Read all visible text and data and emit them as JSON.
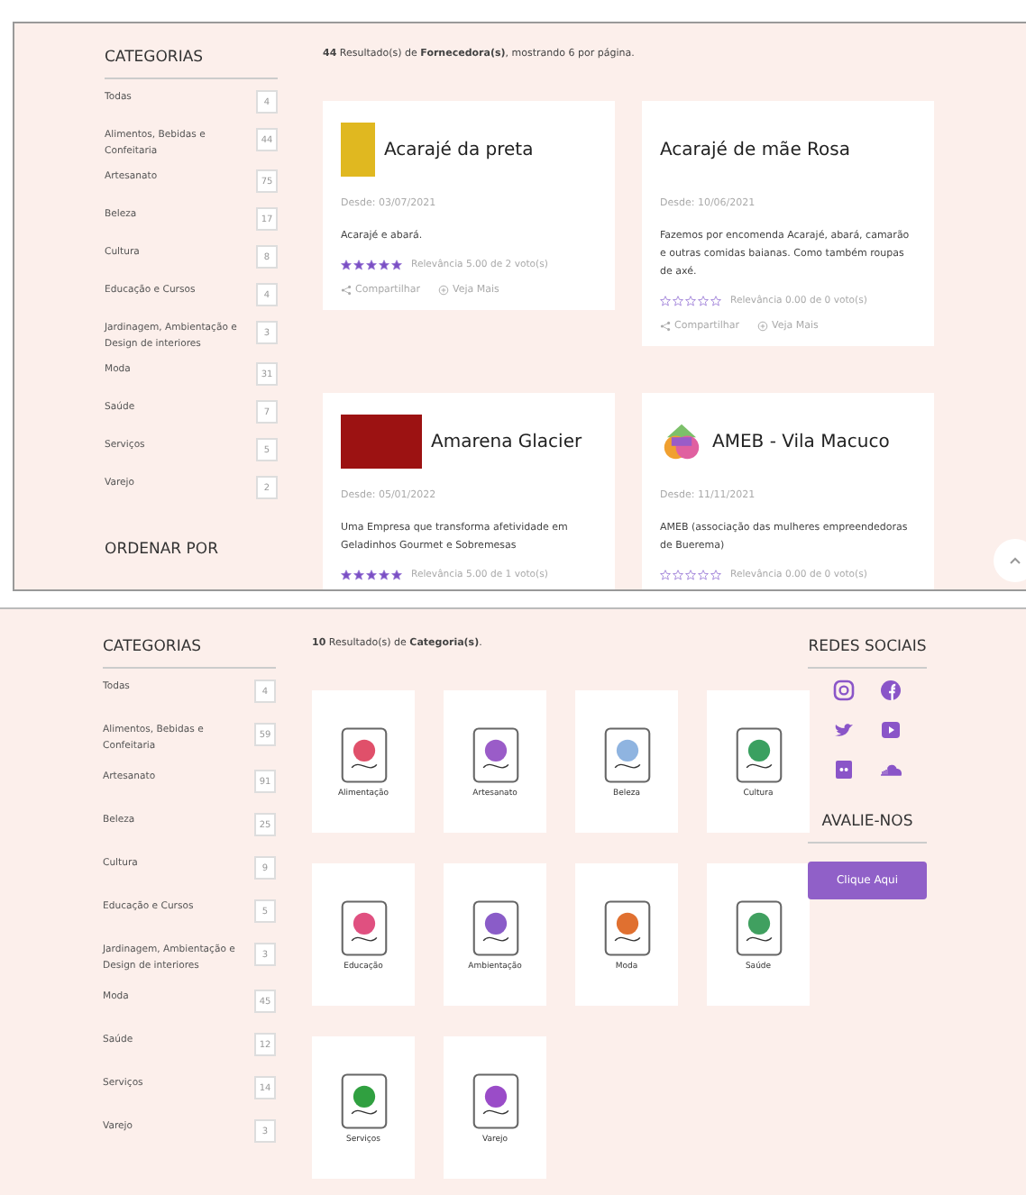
{
  "top_panel": {
    "sidebar": {
      "title": "CATEGORIAS",
      "items": [
        {
          "label": "Todas",
          "count": "4"
        },
        {
          "label": "Alimentos, Bebidas e Confeitaria",
          "count": "44"
        },
        {
          "label": "Artesanato",
          "count": "75"
        },
        {
          "label": "Beleza",
          "count": "17"
        },
        {
          "label": "Cultura",
          "count": "8"
        },
        {
          "label": "Educação e Cursos",
          "count": "4"
        },
        {
          "label": "Jardinagem, Ambientação e Design de interiores",
          "count": "3"
        },
        {
          "label": "Moda",
          "count": "31"
        },
        {
          "label": "Saúde",
          "count": "7"
        },
        {
          "label": "Serviços",
          "count": "5"
        },
        {
          "label": "Varejo",
          "count": "2"
        }
      ],
      "section_title": "ORDENAR POR"
    },
    "results": "**44** Resultado(s) de **Fornecedora(s)**, mostrando 6 por página.",
    "cards": [
      {
        "kind": "photo",
        "color": "#e0b820",
        "name": "Acarajé da preta",
        "since": "Desde: 03/07/2021",
        "description": "Acarajé e abará.",
        "stars": 5,
        "rating": "Relevância 5.00 de 2 voto(s)",
        "share": "Compartilhar",
        "more": "Veja Mais"
      },
      {
        "kind": "plain",
        "name": "Acarajé de mãe Rosa",
        "since": "Desde: 10/06/2021",
        "description": "Fazemos por encomenda Acarajé, abará, camarão e outras comidas baianas. Como também roupas de axé.",
        "stars": 0,
        "rating": "Relevância 0.00 de 0 voto(s)",
        "share": "Compartilhar",
        "more": "Veja Mais"
      },
      {
        "kind": "photo",
        "color": "#9c1212",
        "name": "Amarena Glacier",
        "since": "Desde: 05/01/2022",
        "description": "Uma Empresa que transforma afetividade em Geladinhos Gourmet e Sobremesas",
        "stars": 5,
        "rating": "Relevância 5.00 de 1 voto(s)"
      },
      {
        "kind": "logo",
        "name": "AMEB - Vila Macuco",
        "since": "Desde: 11/11/2021",
        "description": "AMEB (associação das mulheres empreendedoras de Buerema)",
        "stars": 0,
        "rating": "Relevância 0.00 de 0 voto(s)"
      }
    ]
  },
  "bottom_panel": {
    "sidebar": {
      "title": "CATEGORIAS",
      "items": [
        {
          "label": "Todas",
          "count": "4"
        },
        {
          "label": "Alimentos, Bebidas e Confeitaria",
          "count": "59"
        },
        {
          "label": "Artesanato",
          "count": "91"
        },
        {
          "label": "Beleza",
          "count": "25"
        },
        {
          "label": "Cultura",
          "count": "9"
        },
        {
          "label": "Educação e Cursos",
          "count": "5"
        },
        {
          "label": "Jardinagem, Ambientação e Design de interiores",
          "count": "3"
        },
        {
          "label": "Moda",
          "count": "45"
        },
        {
          "label": "Saúde",
          "count": "12"
        },
        {
          "label": "Serviços",
          "count": "14"
        },
        {
          "label": "Varejo",
          "count": "3"
        }
      ]
    },
    "results": "**10** Resultado(s) de **Categoria(s)**.",
    "categories": [
      {
        "label": "Alimentação",
        "color": "#e0506a"
      },
      {
        "label": "Artesanato",
        "color": "#9a5cc8"
      },
      {
        "label": "Beleza",
        "color": "#8fb4e0"
      },
      {
        "label": "Cultura",
        "color": "#3aa060"
      },
      {
        "label": "Educação",
        "color": "#e05080"
      },
      {
        "label": "Ambientação",
        "color": "#8a5cc8"
      },
      {
        "label": "Moda",
        "color": "#e07030"
      },
      {
        "label": "Saúde",
        "color": "#40a060"
      },
      {
        "label": "Serviços",
        "color": "#30a040"
      },
      {
        "label": "Varejo",
        "color": "#9a4cc8"
      }
    ],
    "social_title": "REDES SOCIAIS",
    "rate_title": "AVALIE-NOS",
    "rate_button": "Clique Aqui"
  }
}
